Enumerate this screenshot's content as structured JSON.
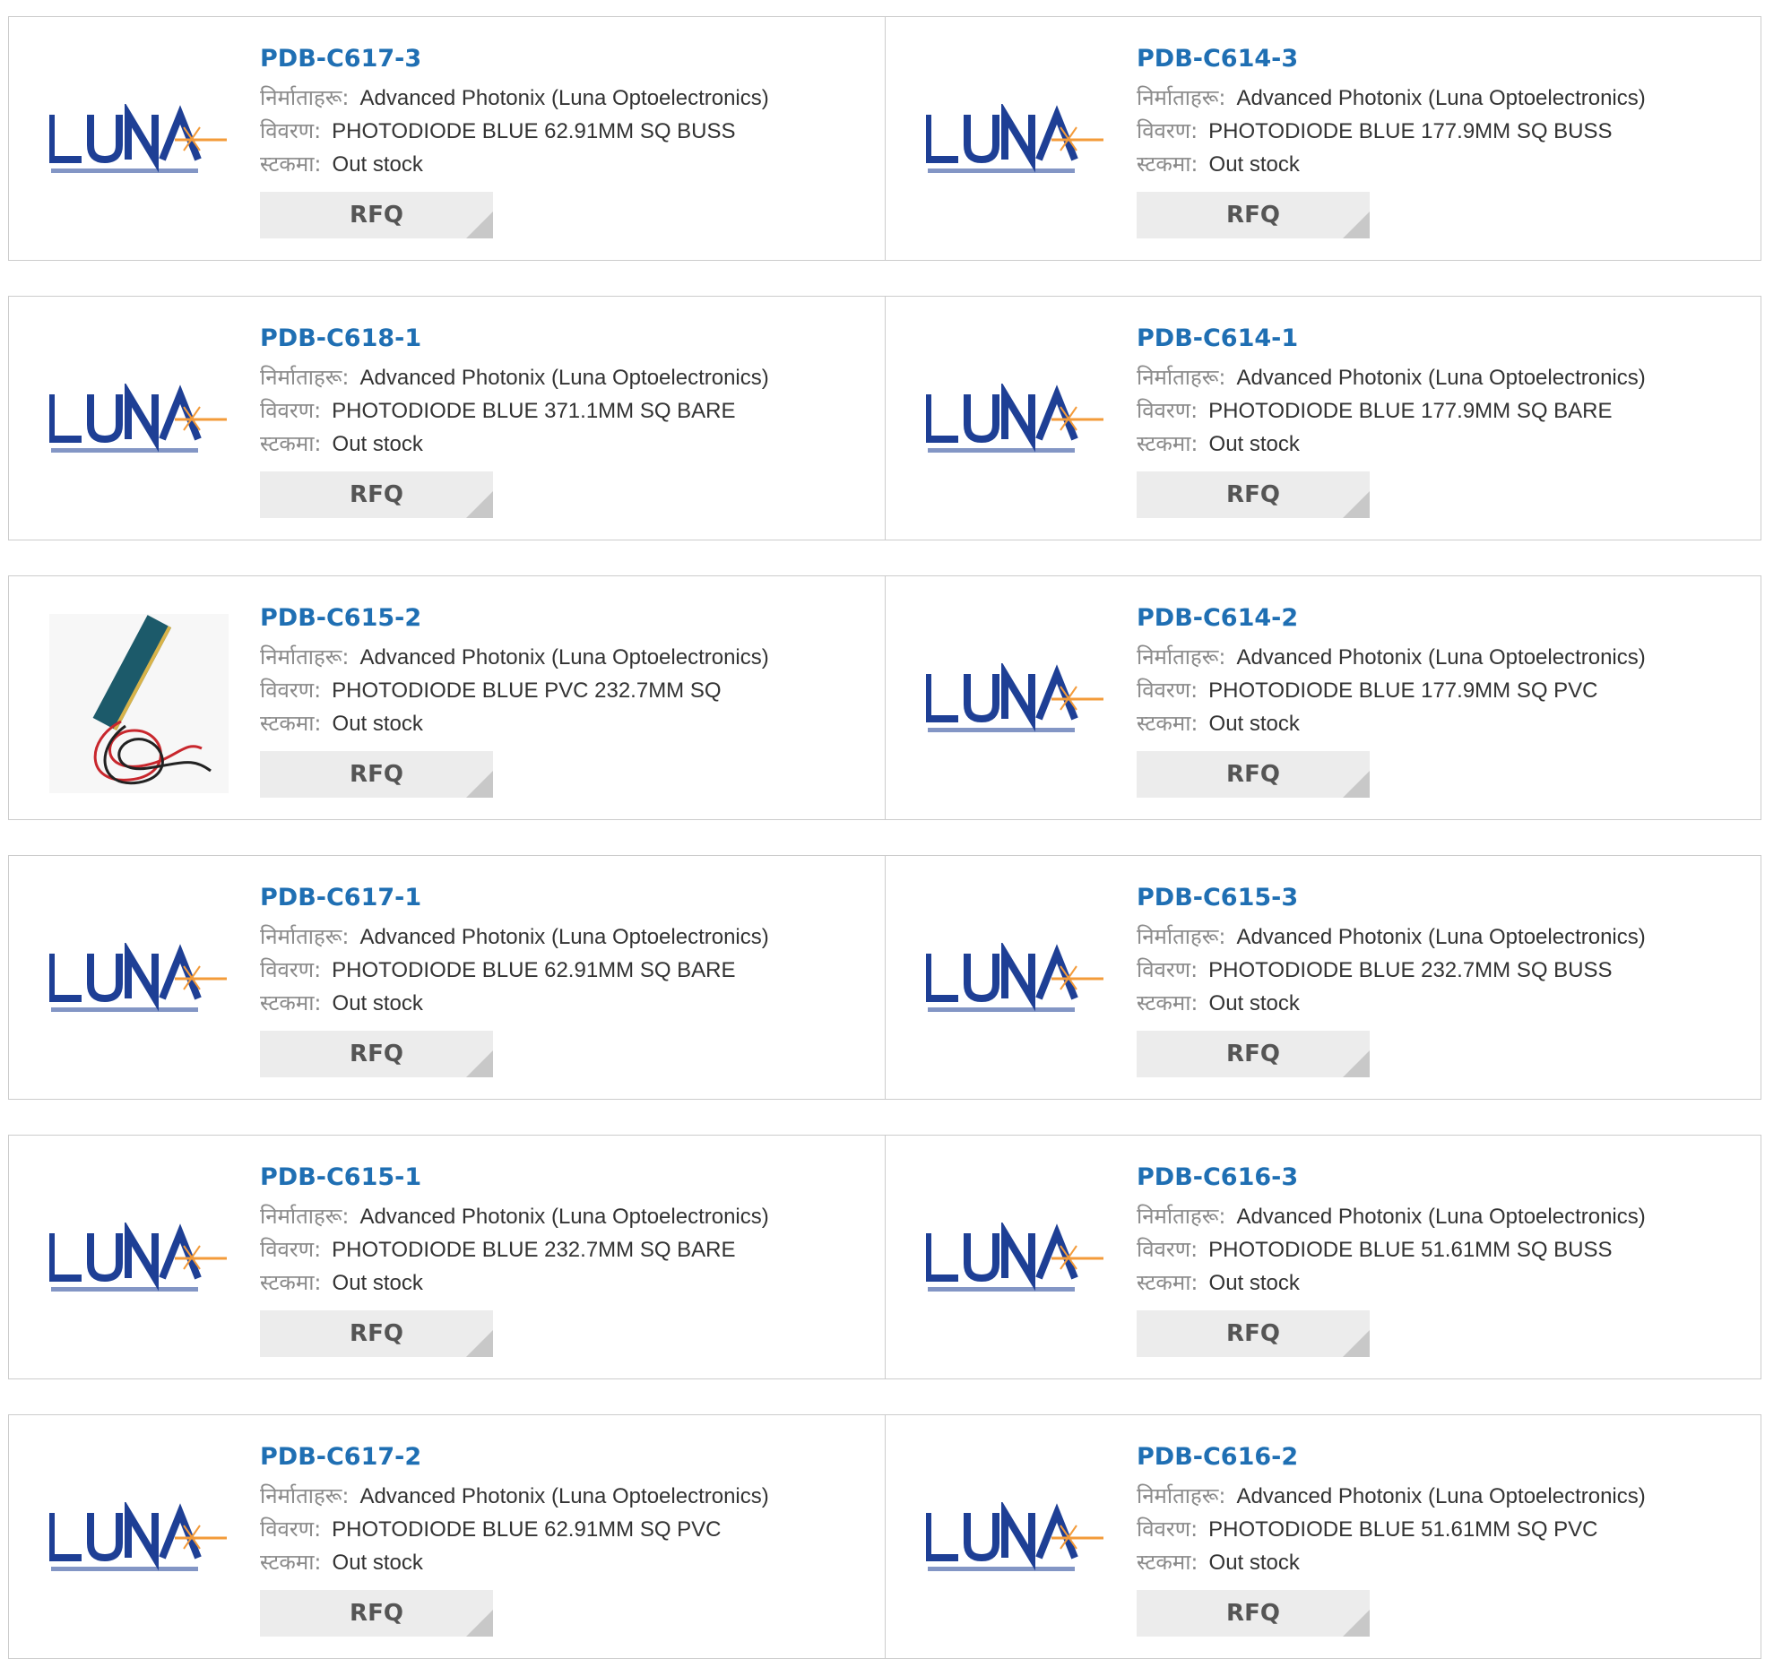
{
  "labels": {
    "manufacturer": "निर्माताहरू:",
    "description": "विवरण:",
    "stock": "स्टकमा:",
    "rfq": "RFQ"
  },
  "colors": {
    "part_link": "#1f6fb3",
    "rfq_bg": "#ececec",
    "border": "#cccccc",
    "luna_blue": "#1e3f95",
    "luna_orange": "#f39b3a"
  },
  "products": [
    {
      "part": "PDB-C617-3",
      "manufacturer": "Advanced Photonix (Luna Optoelectronics)",
      "description": "PHOTODIODE BLUE 62.91MM SQ BUSS",
      "stock": "Out stock",
      "image": "luna-logo"
    },
    {
      "part": "PDB-C614-3",
      "manufacturer": "Advanced Photonix (Luna Optoelectronics)",
      "description": "PHOTODIODE BLUE 177.9MM SQ BUSS",
      "stock": "Out stock",
      "image": "luna-logo"
    },
    {
      "part": "PDB-C618-1",
      "manufacturer": "Advanced Photonix (Luna Optoelectronics)",
      "description": "PHOTODIODE BLUE 371.1MM SQ BARE",
      "stock": "Out stock",
      "image": "luna-logo"
    },
    {
      "part": "PDB-C614-1",
      "manufacturer": "Advanced Photonix (Luna Optoelectronics)",
      "description": "PHOTODIODE BLUE 177.9MM SQ BARE",
      "stock": "Out stock",
      "image": "luna-logo"
    },
    {
      "part": "PDB-C615-2",
      "manufacturer": "Advanced Photonix (Luna Optoelectronics)",
      "description": "PHOTODIODE BLUE PVC 232.7MM SQ",
      "stock": "Out stock",
      "image": "photodiode-photo"
    },
    {
      "part": "PDB-C614-2",
      "manufacturer": "Advanced Photonix (Luna Optoelectronics)",
      "description": "PHOTODIODE BLUE 177.9MM SQ PVC",
      "stock": "Out stock",
      "image": "luna-logo"
    },
    {
      "part": "PDB-C617-1",
      "manufacturer": "Advanced Photonix (Luna Optoelectronics)",
      "description": "PHOTODIODE BLUE 62.91MM SQ BARE",
      "stock": "Out stock",
      "image": "luna-logo"
    },
    {
      "part": "PDB-C615-3",
      "manufacturer": "Advanced Photonix (Luna Optoelectronics)",
      "description": "PHOTODIODE BLUE 232.7MM SQ BUSS",
      "stock": "Out stock",
      "image": "luna-logo"
    },
    {
      "part": "PDB-C615-1",
      "manufacturer": "Advanced Photonix (Luna Optoelectronics)",
      "description": "PHOTODIODE BLUE 232.7MM SQ BARE",
      "stock": "Out stock",
      "image": "luna-logo"
    },
    {
      "part": "PDB-C616-3",
      "manufacturer": "Advanced Photonix (Luna Optoelectronics)",
      "description": "PHOTODIODE BLUE 51.61MM SQ BUSS",
      "stock": "Out stock",
      "image": "luna-logo"
    },
    {
      "part": "PDB-C617-2",
      "manufacturer": "Advanced Photonix (Luna Optoelectronics)",
      "description": "PHOTODIODE BLUE 62.91MM SQ PVC",
      "stock": "Out stock",
      "image": "luna-logo"
    },
    {
      "part": "PDB-C616-2",
      "manufacturer": "Advanced Photonix (Luna Optoelectronics)",
      "description": "PHOTODIODE BLUE 51.61MM SQ PVC",
      "stock": "Out stock",
      "image": "luna-logo"
    }
  ]
}
